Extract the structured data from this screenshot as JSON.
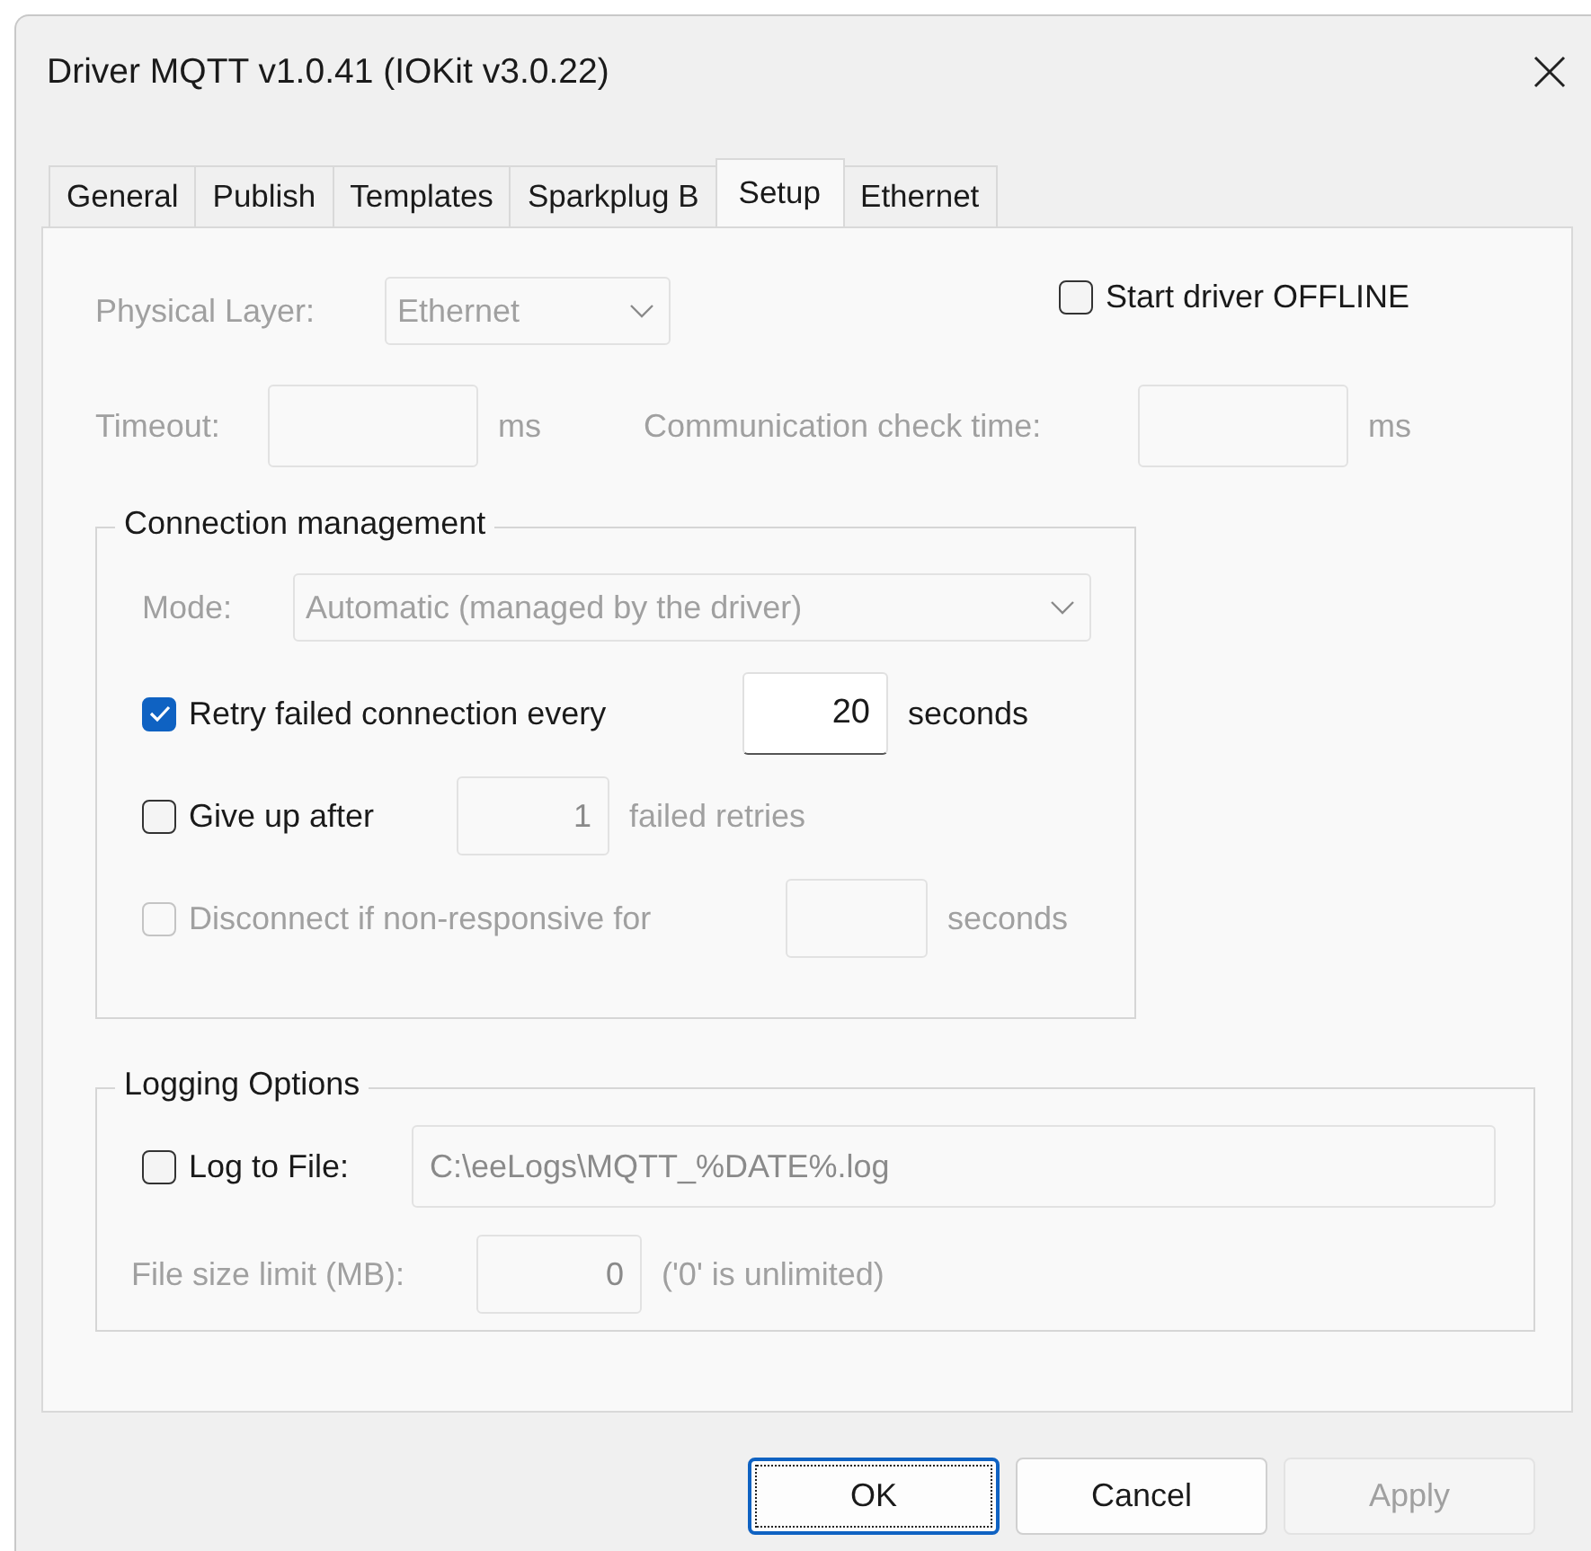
{
  "window": {
    "title": "Driver MQTT v1.0.41 (IOKit v3.0.22)"
  },
  "tabs": [
    {
      "label": "General",
      "selected": false
    },
    {
      "label": "Publish",
      "selected": false
    },
    {
      "label": "Templates",
      "selected": false
    },
    {
      "label": "Sparkplug B",
      "selected": false
    },
    {
      "label": "Setup",
      "selected": true
    },
    {
      "label": "Ethernet",
      "selected": false
    }
  ],
  "physical_layer": {
    "label": "Physical Layer:",
    "value": "Ethernet",
    "disabled": true
  },
  "start_offline": {
    "label": "Start driver OFFLINE",
    "checked": false
  },
  "timeout": {
    "label": "Timeout:",
    "unit": "ms",
    "disabled": true
  },
  "communication_check": {
    "label": "Communication check time:",
    "unit": "ms",
    "disabled": true
  },
  "connection_management": {
    "legend": "Connection management",
    "mode": {
      "label": "Mode:",
      "value": "Automatic (managed by the driver)",
      "disabled": true
    },
    "options": [
      {
        "label": "Retry failed connection every",
        "checked": true,
        "disabled": false,
        "value": "20",
        "unit": "seconds",
        "field_disabled": false
      },
      {
        "label": "Give up after",
        "checked": false,
        "disabled": false,
        "value": "1",
        "unit": "failed retries",
        "field_disabled": true
      },
      {
        "label": "Disconnect if non-responsive for",
        "checked": false,
        "disabled": true,
        "unit": "seconds",
        "field_disabled": true
      }
    ]
  },
  "logging": {
    "legend": "Logging Options",
    "log_to_file": {
      "label": "Log to File:",
      "checked": false,
      "value": "C:\\eeLogs\\MQTT_%DATE%.log",
      "field_disabled": true
    },
    "file_size": {
      "label": "File size limit (MB):",
      "value": "0",
      "note": "('0' is unlimited)",
      "disabled": true
    }
  },
  "buttons": [
    {
      "label": "OK",
      "default": true,
      "disabled": false
    },
    {
      "label": "Cancel",
      "default": false,
      "disabled": false
    },
    {
      "label": "Apply",
      "default": false,
      "disabled": true
    }
  ]
}
